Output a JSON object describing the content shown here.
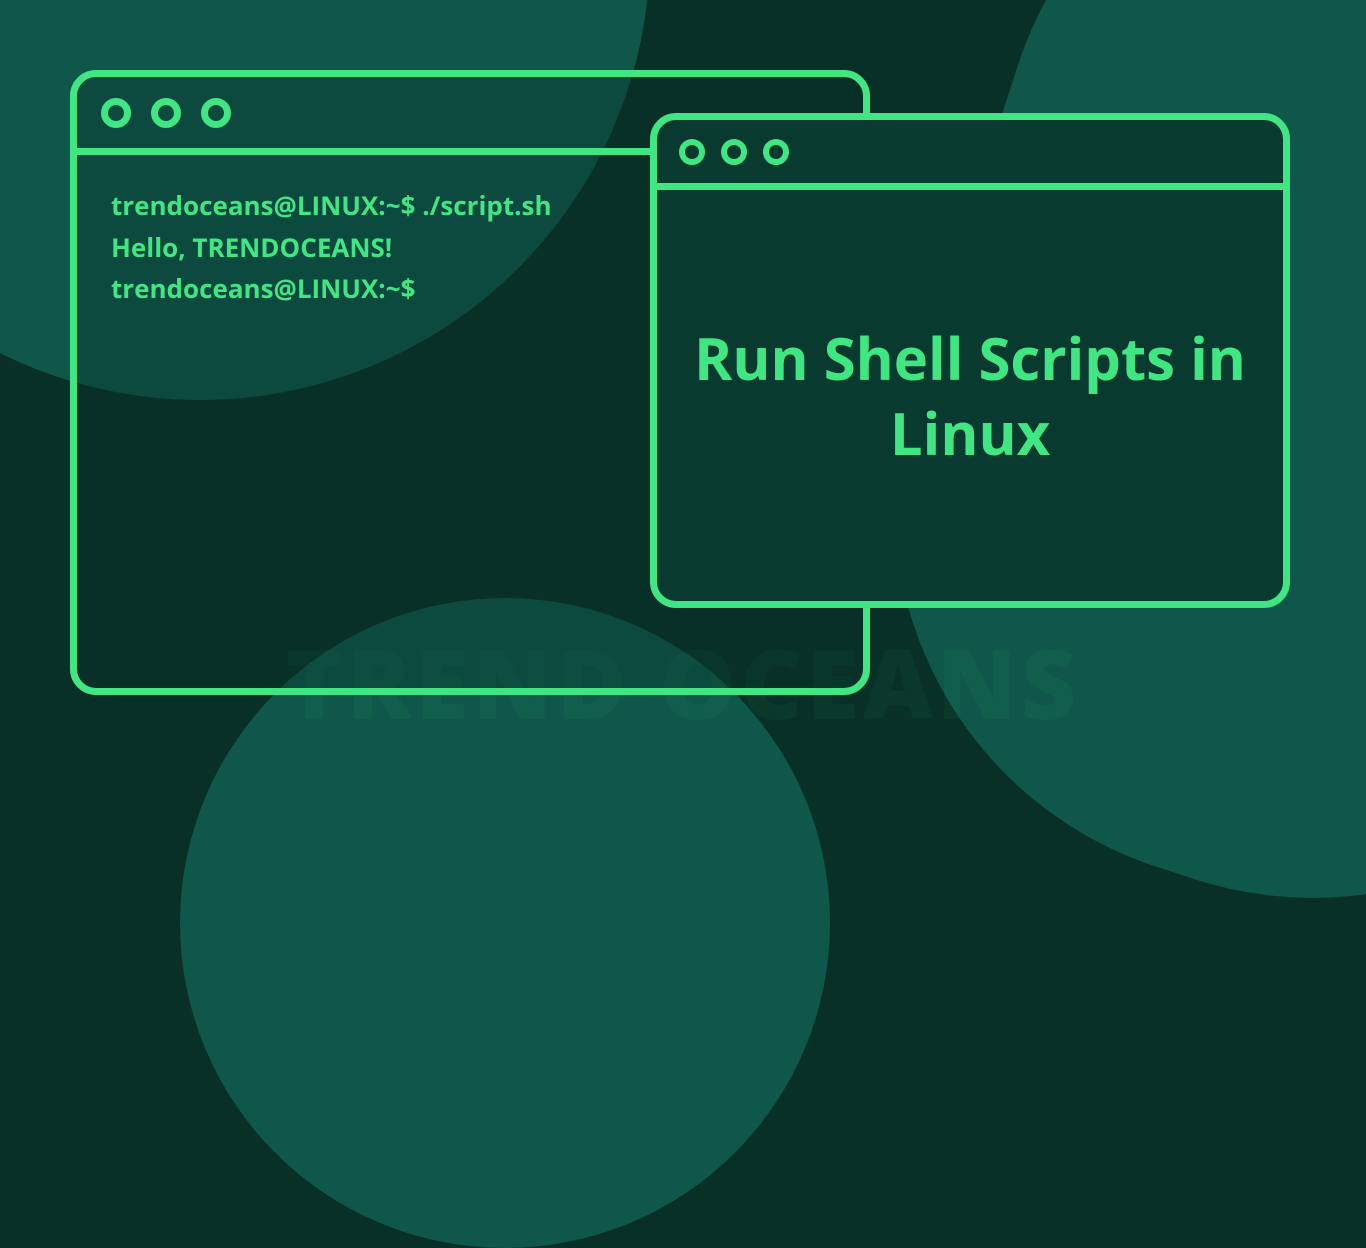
{
  "terminal": {
    "line1_prompt": "trendoceans@LINUX:~$ ",
    "line1_cmd": "./script.sh",
    "line2": "Hello, TRENDOCEANS!",
    "line3": "trendoceans@LINUX:~$"
  },
  "title_window": {
    "heading": "Run Shell Scripts in Linux"
  },
  "watermark": "TREND OCEANS",
  "colors": {
    "accent": "#40e682",
    "bg_dark": "#083027",
    "bg_shape": "#0f574a"
  }
}
